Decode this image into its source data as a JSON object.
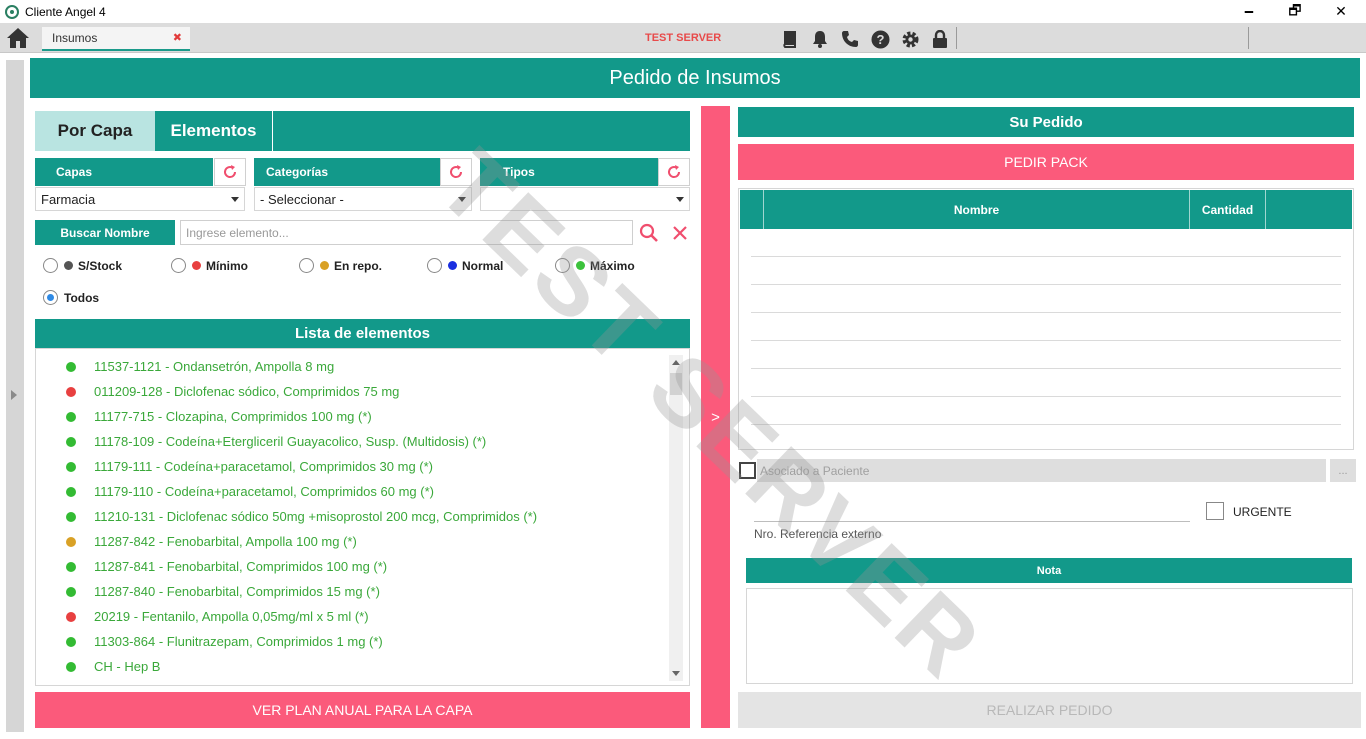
{
  "window": {
    "title": "Cliente Angel 4",
    "minimize": "🗕",
    "maximize": "🗗",
    "close": "✕"
  },
  "toolbar": {
    "tab_label": "Insumos",
    "tab_close": "✖",
    "server_label": "TEST SERVER",
    "icons": [
      "home-icon",
      "book-icon",
      "bell-icon",
      "phone-icon",
      "help-icon",
      "gear-icon",
      "lock-icon"
    ]
  },
  "page": {
    "title": "Pedido de Insumos"
  },
  "left": {
    "tabs": [
      "Por Capa",
      "Elementos"
    ],
    "filters": {
      "capas_label": "Capas",
      "capas_value": "Farmacia",
      "categorias_label": "Categorías",
      "categorias_value": "- Seleccionar -",
      "tipos_label": "Tipos",
      "tipos_value": ""
    },
    "search": {
      "label": "Buscar Nombre",
      "placeholder": "Ingrese elemento...",
      "value": ""
    },
    "radios": [
      {
        "label": "S/Stock",
        "color": "#555555",
        "checked": false
      },
      {
        "label": "Mínimo",
        "color": "#e84040",
        "checked": false
      },
      {
        "label": "En repo.",
        "color": "#d9a126",
        "checked": false
      },
      {
        "label": "Normal",
        "color": "#1a2fe0",
        "checked": false
      },
      {
        "label": "Máximo",
        "color": "#3cc23c",
        "checked": false
      },
      {
        "label": "Todos",
        "color": "",
        "checked": true
      }
    ],
    "list_title": "Lista de elementos",
    "items": [
      {
        "text": "11537-1121 - Ondansetrón, Ampolla 8 mg",
        "status_color": "#33bb33"
      },
      {
        "text": "011209-128 - Diclofenac sódico, Comprimidos 75 mg",
        "status_color": "#e84040"
      },
      {
        "text": "11177-715 - Clozapina, Comprimidos 100 mg (*)",
        "status_color": "#33bb33"
      },
      {
        "text": "11178-109 - Codeína+Etergliceril Guayacolico, Susp. (Multidosis) (*)",
        "status_color": "#33bb33"
      },
      {
        "text": "11179-111 - Codeína+paracetamol, Comprimidos 30 mg (*)",
        "status_color": "#33bb33"
      },
      {
        "text": "11179-110 - Codeína+paracetamol, Comprimidos 60 mg (*)",
        "status_color": "#33bb33"
      },
      {
        "text": "11210-131 - Diclofenac sódico 50mg +misoprostol 200 mcg, Comprimidos (*)",
        "status_color": "#33bb33"
      },
      {
        "text": "11287-842 - Fenobarbital, Ampolla 100 mg (*)",
        "status_color": "#d9a126"
      },
      {
        "text": "11287-841 - Fenobarbital, Comprimidos 100 mg (*)",
        "status_color": "#33bb33"
      },
      {
        "text": "11287-840 - Fenobarbital, Comprimidos 15 mg (*)",
        "status_color": "#33bb33"
      },
      {
        "text": "20219 - Fentanilo, Ampolla 0,05mg/ml x 5 ml (*)",
        "status_color": "#e84040"
      },
      {
        "text": "11303-864 - Flunitrazepam, Comprimidos 1 mg (*)",
        "status_color": "#33bb33"
      },
      {
        "text": "CH - Hep B",
        "status_color": "#33bb33"
      }
    ],
    "ver_plan_label": "VER PLAN ANUAL PARA LA CAPA"
  },
  "middle": {
    "arrow_label": ">"
  },
  "right": {
    "title": "Su Pedido",
    "pedir_pack_label": "PEDIR PACK",
    "table_headers": [
      "Nombre",
      "Cantidad"
    ],
    "asociado_label": "Asociado a Paciente",
    "asociado_btn": "...",
    "urgente_label": "URGENTE",
    "ref_label": "Nro. Referencia externo",
    "nota_label": "Nota",
    "realizar_label": "REALIZAR PEDIDO"
  },
  "watermark": "TEST SERVER",
  "colors": {
    "teal": "#12998a",
    "pink": "#fb5a7b",
    "tab_active": "#b9e4e1"
  }
}
